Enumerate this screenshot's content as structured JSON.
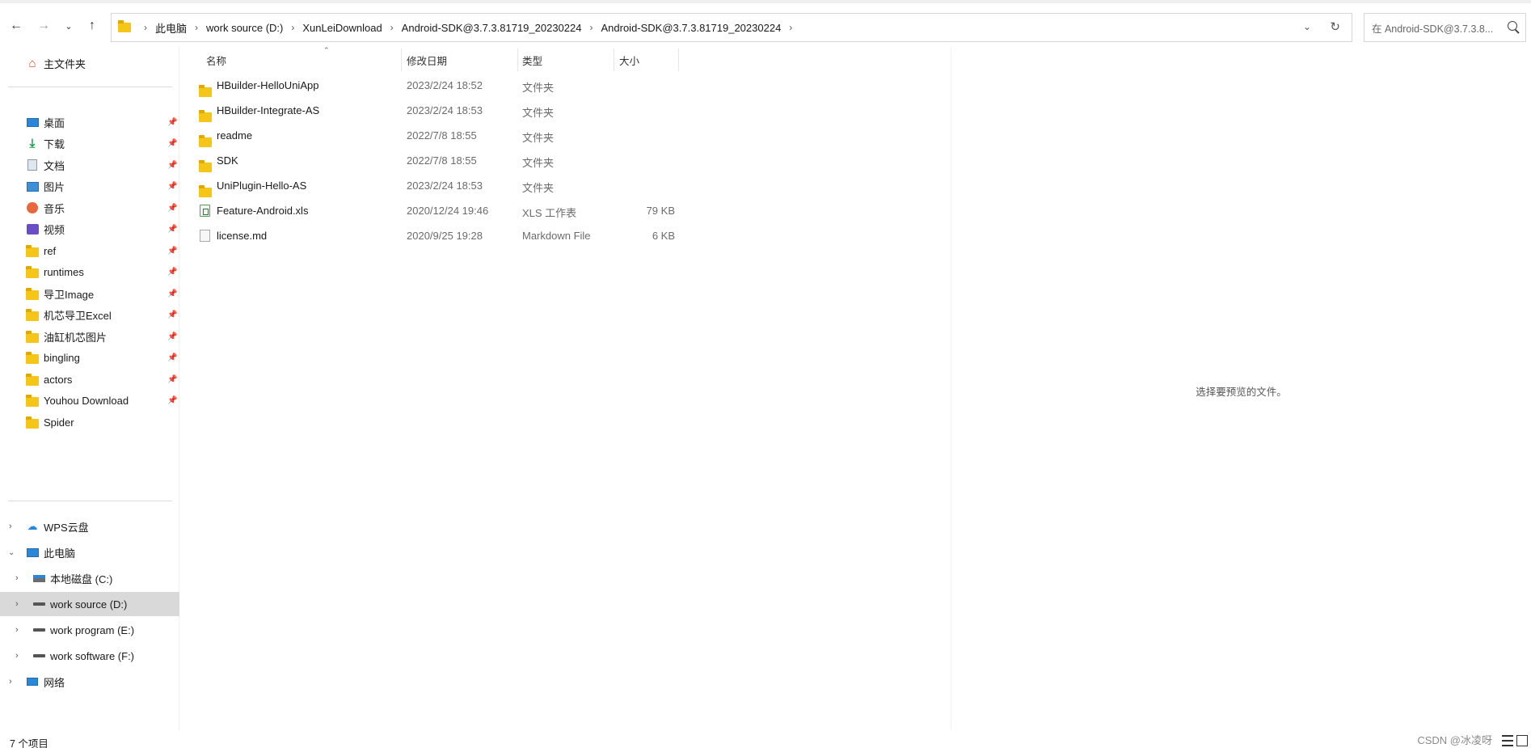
{
  "address": {
    "crumbs": [
      "此电脑",
      "work source (D:)",
      "XunLeiDownload",
      "Android-SDK@3.7.3.81719_20230224",
      "Android-SDK@3.7.3.81719_20230224"
    ]
  },
  "search": {
    "placeholder": "在 Android-SDK@3.7.3.8..."
  },
  "sidebar": {
    "home": "主文件夹",
    "quick_access": [
      {
        "label": "桌面",
        "icon": "desktop-icon"
      },
      {
        "label": "下载",
        "icon": "download-icon"
      },
      {
        "label": "文档",
        "icon": "document-icon"
      },
      {
        "label": "图片",
        "icon": "picture-icon"
      },
      {
        "label": "音乐",
        "icon": "music-icon"
      },
      {
        "label": "视频",
        "icon": "video-icon"
      },
      {
        "label": "ref",
        "icon": "folder-icon"
      },
      {
        "label": "runtimes",
        "icon": "folder-icon"
      },
      {
        "label": "导卫Image",
        "icon": "folder-icon"
      },
      {
        "label": "机芯导卫Excel",
        "icon": "folder-icon"
      },
      {
        "label": "油缸机芯图片",
        "icon": "folder-icon"
      },
      {
        "label": "bingling",
        "icon": "folder-icon"
      },
      {
        "label": "actors",
        "icon": "folder-icon"
      },
      {
        "label": "Youhou Download",
        "icon": "folder-icon"
      },
      {
        "label": "Spider",
        "icon": "folder-icon"
      }
    ],
    "wps": "WPS云盘",
    "this_pc": "此电脑",
    "drives": [
      {
        "label": "本地磁盘 (C:)",
        "icon": "system-drive-icon"
      },
      {
        "label": "work source (D:)",
        "icon": "drive-icon",
        "selected": true
      },
      {
        "label": "work program (E:)",
        "icon": "drive-icon"
      },
      {
        "label": "work software (F:)",
        "icon": "drive-icon"
      }
    ],
    "network": "网络"
  },
  "columns": {
    "name": "名称",
    "date": "修改日期",
    "type": "类型",
    "size": "大小"
  },
  "files": [
    {
      "name": "HBuilder-HelloUniApp",
      "date": "2023/2/24 18:52",
      "type": "文件夹",
      "size": "",
      "kind": "folder"
    },
    {
      "name": "HBuilder-Integrate-AS",
      "date": "2023/2/24 18:53",
      "type": "文件夹",
      "size": "",
      "kind": "folder"
    },
    {
      "name": "readme",
      "date": "2022/7/8 18:55",
      "type": "文件夹",
      "size": "",
      "kind": "folder"
    },
    {
      "name": "SDK",
      "date": "2022/7/8 18:55",
      "type": "文件夹",
      "size": "",
      "kind": "folder"
    },
    {
      "name": "UniPlugin-Hello-AS",
      "date": "2023/2/24 18:53",
      "type": "文件夹",
      "size": "",
      "kind": "folder"
    },
    {
      "name": "Feature-Android.xls",
      "date": "2020/12/24 19:46",
      "type": "XLS 工作表",
      "size": "79 KB",
      "kind": "xls"
    },
    {
      "name": "license.md",
      "date": "2020/9/25 19:28",
      "type": "Markdown File",
      "size": "6 KB",
      "kind": "md"
    }
  ],
  "preview": {
    "text": "选择要预览的文件。"
  },
  "status": {
    "count": "7 个项目",
    "watermark": "CSDN @冰凌呀"
  }
}
